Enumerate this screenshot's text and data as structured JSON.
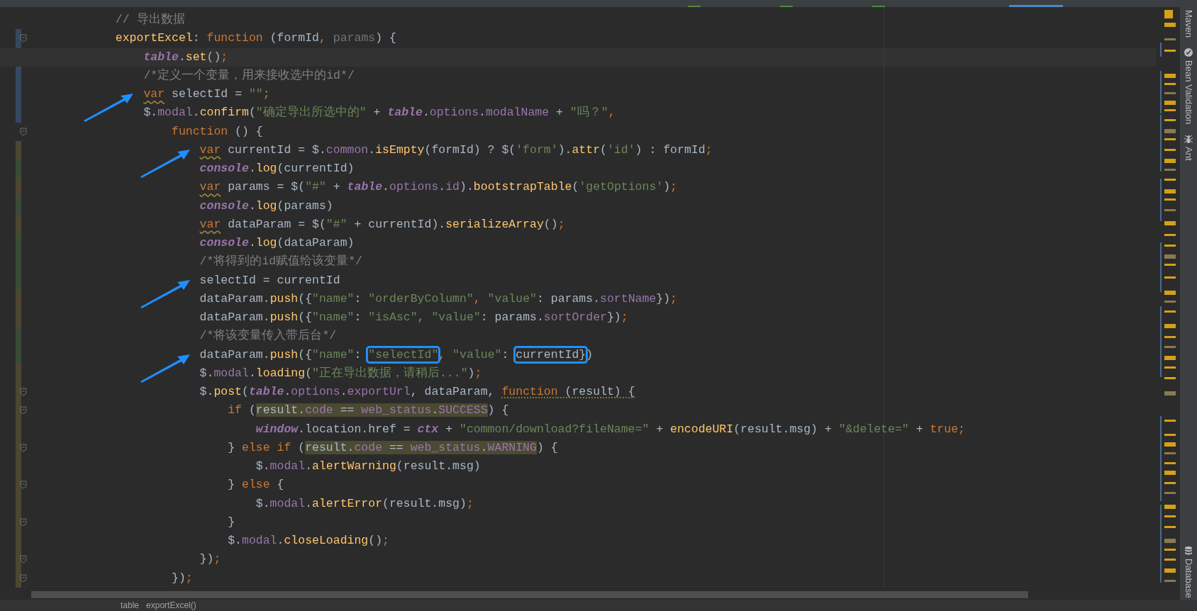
{
  "editor": {
    "lines": [
      {
        "fold": false,
        "current": false,
        "arrow": false,
        "tokens": [
          {
            "kind": "comment",
            "text": "// 导出数据"
          }
        ]
      },
      {
        "color": "#34495e",
        "fold": true,
        "current": false,
        "arrow": false,
        "tokens": [
          {
            "kind": "function",
            "text": "exportExcel"
          },
          {
            "kind": "plain",
            "text": ": "
          },
          {
            "kind": "keyword",
            "text": "function"
          },
          {
            "kind": "plain",
            "text": " (formId"
          },
          {
            "kind": "keyword",
            "text": ","
          },
          {
            "kind": "unused",
            "text": " params"
          },
          {
            "kind": "plain",
            "text": ") {"
          }
        ],
        "children": [
          {
            "fold": false,
            "current": true,
            "arrow": false,
            "tokens": [
              {
                "kind": "global",
                "text": "table"
              },
              {
                "kind": "plain",
                "text": "."
              },
              {
                "kind": "function",
                "text": "set"
              },
              {
                "kind": "plain",
                "text": "()"
              },
              {
                "kind": "keyword",
                "text": ";"
              }
            ]
          },
          {
            "color": "#34495e",
            "fold": false,
            "current": false,
            "arrow": false,
            "tokens": [
              {
                "kind": "comment",
                "text": "/*定义一个变量，用来接收选中的id*/"
              }
            ]
          },
          {
            "color": "#34495e",
            "fold": false,
            "current": false,
            "arrow": true,
            "tokens": [
              {
                "kind": "keyword",
                "text": "var",
                "warning": true
              },
              {
                "kind": "plain",
                "text": " selectId = "
              },
              {
                "kind": "string",
                "text": "\"\""
              },
              {
                "kind": "keyword",
                "text": ";"
              }
            ]
          },
          {
            "color": "#34495e",
            "fold": false,
            "current": false,
            "arrow": false,
            "tokens": [
              {
                "kind": "plain",
                "text": "$."
              },
              {
                "kind": "member",
                "text": "modal"
              },
              {
                "kind": "plain",
                "text": "."
              },
              {
                "kind": "function",
                "text": "confirm"
              },
              {
                "kind": "plain",
                "text": "("
              },
              {
                "kind": "string",
                "text": "\"确定导出所选中的\""
              },
              {
                "kind": "plain",
                "text": " + "
              },
              {
                "kind": "global",
                "text": "table"
              },
              {
                "kind": "plain",
                "text": "."
              },
              {
                "kind": "member",
                "text": "options"
              },
              {
                "kind": "plain",
                "text": "."
              },
              {
                "kind": "member",
                "text": "modalName"
              },
              {
                "kind": "plain",
                "text": " + "
              },
              {
                "kind": "string",
                "text": "\"吗？\""
              },
              {
                "kind": "keyword",
                "text": ","
              }
            ],
            "children": [
              {
                "fold": true,
                "current": false,
                "arrow": false,
                "tokens": [
                  {
                    "kind": "keyword",
                    "text": "function"
                  },
                  {
                    "kind": "plain",
                    "text": " () {"
                  }
                ],
                "children": [
                  {
                    "color": "#4d4631",
                    "fold": false,
                    "current": false,
                    "arrow": true,
                    "tokens": [
                      {
                        "kind": "keyword",
                        "text": "var",
                        "warning": true
                      },
                      {
                        "kind": "plain",
                        "text": " currentId = $."
                      },
                      {
                        "kind": "member",
                        "text": "common"
                      },
                      {
                        "kind": "plain",
                        "text": "."
                      },
                      {
                        "kind": "function",
                        "text": "isEmpty"
                      },
                      {
                        "kind": "plain",
                        "text": "(formId) ? $("
                      },
                      {
                        "kind": "string",
                        "text": "'form'"
                      },
                      {
                        "kind": "plain",
                        "text": ")."
                      },
                      {
                        "kind": "function",
                        "text": "attr"
                      },
                      {
                        "kind": "plain",
                        "text": "("
                      },
                      {
                        "kind": "string",
                        "text": "'id'"
                      },
                      {
                        "kind": "plain",
                        "text": ") : formId"
                      },
                      {
                        "kind": "keyword",
                        "text": ";"
                      }
                    ]
                  },
                  {
                    "color": "#384c38",
                    "fold": false,
                    "current": false,
                    "arrow": false,
                    "tokens": [
                      {
                        "kind": "global",
                        "text": "console"
                      },
                      {
                        "kind": "plain",
                        "text": "."
                      },
                      {
                        "kind": "function",
                        "text": "log"
                      },
                      {
                        "kind": "plain",
                        "text": "(currentId)"
                      }
                    ]
                  },
                  {
                    "color": "#4d4631",
                    "fold": false,
                    "current": false,
                    "arrow": false,
                    "tokens": [
                      {
                        "kind": "keyword",
                        "text": "var",
                        "warning": true
                      },
                      {
                        "kind": "plain",
                        "text": " params = $("
                      },
                      {
                        "kind": "string",
                        "text": "\"#\""
                      },
                      {
                        "kind": "plain",
                        "text": " + "
                      },
                      {
                        "kind": "global",
                        "text": "table"
                      },
                      {
                        "kind": "plain",
                        "text": "."
                      },
                      {
                        "kind": "member",
                        "text": "options"
                      },
                      {
                        "kind": "plain",
                        "text": "."
                      },
                      {
                        "kind": "member",
                        "text": "id"
                      },
                      {
                        "kind": "plain",
                        "text": ")."
                      },
                      {
                        "kind": "function",
                        "text": "bootstrapTable"
                      },
                      {
                        "kind": "plain",
                        "text": "("
                      },
                      {
                        "kind": "string",
                        "text": "'getOptions'"
                      },
                      {
                        "kind": "plain",
                        "text": ")"
                      },
                      {
                        "kind": "keyword",
                        "text": ";"
                      }
                    ]
                  },
                  {
                    "color": "#384c38",
                    "fold": false,
                    "current": false,
                    "arrow": false,
                    "tokens": [
                      {
                        "kind": "global",
                        "text": "console"
                      },
                      {
                        "kind": "plain",
                        "text": "."
                      },
                      {
                        "kind": "function",
                        "text": "log"
                      },
                      {
                        "kind": "plain",
                        "text": "(params)"
                      }
                    ]
                  },
                  {
                    "color": "#4d4631",
                    "fold": false,
                    "current": false,
                    "arrow": false,
                    "tokens": [
                      {
                        "kind": "keyword",
                        "text": "var",
                        "warning": true
                      },
                      {
                        "kind": "plain",
                        "text": " dataParam = $("
                      },
                      {
                        "kind": "string",
                        "text": "\"#\""
                      },
                      {
                        "kind": "plain",
                        "text": " + currentId)."
                      },
                      {
                        "kind": "function",
                        "text": "serializeArray"
                      },
                      {
                        "kind": "plain",
                        "text": "()"
                      },
                      {
                        "kind": "keyword",
                        "text": ";"
                      }
                    ]
                  },
                  {
                    "color": "#384c38",
                    "fold": false,
                    "current": false,
                    "arrow": false,
                    "tokens": [
                      {
                        "kind": "global",
                        "text": "console"
                      },
                      {
                        "kind": "plain",
                        "text": "."
                      },
                      {
                        "kind": "function",
                        "text": "log"
                      },
                      {
                        "kind": "plain",
                        "text": "(dataParam)"
                      }
                    ]
                  },
                  {
                    "color": "#384c38",
                    "fold": false,
                    "current": false,
                    "arrow": false,
                    "tokens": [
                      {
                        "kind": "comment",
                        "text": "/*将得到的id赋值给该变量*/"
                      }
                    ]
                  },
                  {
                    "color": "#384c38",
                    "fold": false,
                    "current": false,
                    "arrow": true,
                    "tokens": [
                      {
                        "kind": "plain",
                        "text": "selectId = currentId"
                      }
                    ]
                  },
                  {
                    "color": "#4d4631",
                    "fold": false,
                    "current": false,
                    "arrow": false,
                    "tokens": [
                      {
                        "kind": "plain",
                        "text": "dataParam."
                      },
                      {
                        "kind": "function",
                        "text": "push"
                      },
                      {
                        "kind": "plain",
                        "text": "({"
                      },
                      {
                        "kind": "string",
                        "text": "\"name\""
                      },
                      {
                        "kind": "plain",
                        "text": ": "
                      },
                      {
                        "kind": "string",
                        "text": "\"orderByColumn\""
                      },
                      {
                        "kind": "keyword",
                        "text": ","
                      },
                      {
                        "kind": "string",
                        "text": " \"value\""
                      },
                      {
                        "kind": "plain",
                        "text": ": params."
                      },
                      {
                        "kind": "member",
                        "text": "sortName"
                      },
                      {
                        "kind": "plain",
                        "text": "})"
                      },
                      {
                        "kind": "keyword",
                        "text": ";"
                      }
                    ]
                  },
                  {
                    "color": "#4d4631",
                    "fold": false,
                    "current": false,
                    "arrow": false,
                    "tokens": [
                      {
                        "kind": "plain",
                        "text": "dataParam."
                      },
                      {
                        "kind": "function",
                        "text": "push"
                      },
                      {
                        "kind": "plain",
                        "text": "({"
                      },
                      {
                        "kind": "string",
                        "text": "\"name\""
                      },
                      {
                        "kind": "plain",
                        "text": ": "
                      },
                      {
                        "kind": "string",
                        "text": "\"isAsc\""
                      },
                      {
                        "kind": "keyword",
                        "text": ","
                      },
                      {
                        "kind": "string",
                        "text": " \"value\""
                      },
                      {
                        "kind": "plain",
                        "text": ": params."
                      },
                      {
                        "kind": "member",
                        "text": "sortOrder"
                      },
                      {
                        "kind": "plain",
                        "text": "})"
                      },
                      {
                        "kind": "keyword",
                        "text": ";"
                      }
                    ]
                  },
                  {
                    "color": "#384c38",
                    "fold": false,
                    "current": false,
                    "arrow": false,
                    "tokens": [
                      {
                        "kind": "comment",
                        "text": "/*将该变量传入带后台*/"
                      }
                    ]
                  },
                  {
                    "color": "#384c38",
                    "fold": false,
                    "current": false,
                    "arrow": true,
                    "tokens": [
                      {
                        "kind": "plain",
                        "text": "dataParam."
                      },
                      {
                        "kind": "function",
                        "text": "push"
                      },
                      {
                        "kind": "plain",
                        "text": "({"
                      },
                      {
                        "kind": "string",
                        "text": "\"name\""
                      },
                      {
                        "kind": "plain",
                        "text": ": "
                      },
                      {
                        "kind": "string",
                        "text": "\"selectId\"",
                        "boxed": true
                      },
                      {
                        "kind": "keyword",
                        "text": ","
                      },
                      {
                        "kind": "string",
                        "text": " \"value\""
                      },
                      {
                        "kind": "plain",
                        "text": ": "
                      },
                      {
                        "kind": "plain",
                        "text": "currentId}",
                        "boxed": true
                      },
                      {
                        "kind": "plain",
                        "text": ")"
                      }
                    ]
                  },
                  {
                    "color": "#4d4631",
                    "fold": false,
                    "current": false,
                    "arrow": false,
                    "tokens": [
                      {
                        "kind": "plain",
                        "text": "$."
                      },
                      {
                        "kind": "member",
                        "text": "modal"
                      },
                      {
                        "kind": "plain",
                        "text": "."
                      },
                      {
                        "kind": "function",
                        "text": "loading"
                      },
                      {
                        "kind": "plain",
                        "text": "("
                      },
                      {
                        "kind": "string",
                        "text": "\"正在导出数据，请稍后...\""
                      },
                      {
                        "kind": "plain",
                        "text": ")"
                      },
                      {
                        "kind": "keyword",
                        "text": ";"
                      }
                    ]
                  },
                  {
                    "color": "#4d4631",
                    "fold": true,
                    "current": false,
                    "arrow": false,
                    "tokens": [
                      {
                        "kind": "plain",
                        "text": "$."
                      },
                      {
                        "kind": "function",
                        "text": "post"
                      },
                      {
                        "kind": "plain",
                        "text": "("
                      },
                      {
                        "kind": "global",
                        "text": "table"
                      },
                      {
                        "kind": "plain",
                        "text": "."
                      },
                      {
                        "kind": "member",
                        "text": "options"
                      },
                      {
                        "kind": "plain",
                        "text": "."
                      },
                      {
                        "kind": "member",
                        "text": "exportUrl"
                      },
                      {
                        "kind": "plain",
                        "text": ", dataParam, "
                      },
                      {
                        "kind": "keyword",
                        "text": "function",
                        "weak_warning": true
                      },
                      {
                        "kind": "plain",
                        "text": " (result) {",
                        "weak_warning": true
                      }
                    ],
                    "children": [
                      {
                        "color": "#4d4631",
                        "fold": true,
                        "current": false,
                        "arrow": false,
                        "tokens": [
                          {
                            "kind": "keyword",
                            "text": "if"
                          },
                          {
                            "kind": "plain",
                            "text": " ("
                          },
                          {
                            "kind": "plain",
                            "text": "result.",
                            "highlight": true
                          },
                          {
                            "kind": "member",
                            "text": "code",
                            "highlight": true
                          },
                          {
                            "kind": "plain",
                            "text": " == ",
                            "highlight": true
                          },
                          {
                            "kind": "member",
                            "text": "web_status",
                            "highlight": true
                          },
                          {
                            "kind": "plain",
                            "text": ".",
                            "highlight": true
                          },
                          {
                            "kind": "member",
                            "text": "SUCCESS",
                            "highlight": true
                          },
                          {
                            "kind": "plain",
                            "text": ") {"
                          }
                        ],
                        "children": [
                          {
                            "color": "#4d4631",
                            "fold": false,
                            "current": false,
                            "arrow": false,
                            "tokens": [
                              {
                                "kind": "global",
                                "text": "window"
                              },
                              {
                                "kind": "plain",
                                "text": ".location.href = "
                              },
                              {
                                "kind": "global",
                                "text": "ctx"
                              },
                              {
                                "kind": "plain",
                                "text": " + "
                              },
                              {
                                "kind": "string",
                                "text": "\"common/download?fileName=\""
                              },
                              {
                                "kind": "plain",
                                "text": " + "
                              },
                              {
                                "kind": "function",
                                "text": "encodeURI"
                              },
                              {
                                "kind": "plain",
                                "text": "(result.msg) + "
                              },
                              {
                                "kind": "string",
                                "text": "\"&delete=\""
                              },
                              {
                                "kind": "plain",
                                "text": " + "
                              },
                              {
                                "kind": "keyword",
                                "text": "true;"
                              }
                            ]
                          }
                        ]
                      },
                      {
                        "color": "#4d4631",
                        "fold": true,
                        "current": false,
                        "arrow": false,
                        "tokens": [
                          {
                            "kind": "plain",
                            "text": "} "
                          },
                          {
                            "kind": "keyword",
                            "text": "else if"
                          },
                          {
                            "kind": "plain",
                            "text": " ("
                          },
                          {
                            "kind": "plain",
                            "text": "result.",
                            "highlight": true
                          },
                          {
                            "kind": "member",
                            "text": "code",
                            "highlight": true
                          },
                          {
                            "kind": "plain",
                            "text": " == ",
                            "highlight": true
                          },
                          {
                            "kind": "member",
                            "text": "web_status",
                            "highlight": true
                          },
                          {
                            "kind": "plain",
                            "text": ".",
                            "highlight": true
                          },
                          {
                            "kind": "member",
                            "text": "WARNING",
                            "highlight": true
                          },
                          {
                            "kind": "plain",
                            "text": ") {"
                          }
                        ],
                        "children": [
                          {
                            "color": "#4d4631",
                            "fold": false,
                            "current": false,
                            "arrow": false,
                            "tokens": [
                              {
                                "kind": "plain",
                                "text": "$."
                              },
                              {
                                "kind": "member",
                                "text": "modal"
                              },
                              {
                                "kind": "plain",
                                "text": "."
                              },
                              {
                                "kind": "function",
                                "text": "alertWarning"
                              },
                              {
                                "kind": "plain",
                                "text": "(result.msg)"
                              }
                            ]
                          }
                        ]
                      },
                      {
                        "color": "#4d4631",
                        "fold": true,
                        "current": false,
                        "arrow": false,
                        "tokens": [
                          {
                            "kind": "plain",
                            "text": "} "
                          },
                          {
                            "kind": "keyword",
                            "text": "else"
                          },
                          {
                            "kind": "plain",
                            "text": " {"
                          }
                        ],
                        "children": [
                          {
                            "color": "#4d4631",
                            "fold": false,
                            "current": false,
                            "arrow": false,
                            "tokens": [
                              {
                                "kind": "plain",
                                "text": "$."
                              },
                              {
                                "kind": "member",
                                "text": "modal"
                              },
                              {
                                "kind": "plain",
                                "text": "."
                              },
                              {
                                "kind": "function",
                                "text": "alertError"
                              },
                              {
                                "kind": "plain",
                                "text": "(result.msg)"
                              },
                              {
                                "kind": "keyword",
                                "text": ";"
                              }
                            ]
                          }
                        ]
                      },
                      {
                        "color": "#4d4631",
                        "fold": true,
                        "current": false,
                        "arrow": false,
                        "tokens": [
                          {
                            "kind": "plain",
                            "text": "}"
                          }
                        ]
                      },
                      {
                        "color": "#4d4631",
                        "fold": false,
                        "current": false,
                        "arrow": false,
                        "tokens": [
                          {
                            "kind": "plain",
                            "text": "$."
                          },
                          {
                            "kind": "member",
                            "text": "modal"
                          },
                          {
                            "kind": "plain",
                            "text": "."
                          },
                          {
                            "kind": "function",
                            "text": "closeLoading"
                          },
                          {
                            "kind": "plain",
                            "text": "()"
                          },
                          {
                            "kind": "keyword",
                            "text": ";"
                          }
                        ]
                      }
                    ]
                  },
                  {
                    "color": "#4d4631",
                    "fold": true,
                    "current": false,
                    "arrow": false,
                    "tokens": [
                      {
                        "kind": "plain",
                        "text": "})"
                      },
                      {
                        "kind": "keyword",
                        "text": ";"
                      }
                    ]
                  }
                ]
              },
              {
                "color": "#4d4631",
                "fold": true,
                "current": false,
                "arrow": false,
                "tokens": [
                  {
                    "kind": "plain",
                    "text": "})"
                  },
                  {
                    "kind": "keyword",
                    "text": ";"
                  }
                ]
              }
            ]
          }
        ]
      }
    ]
  },
  "tool_windows": [
    "Maven",
    "Bean Validation",
    "Ant",
    "Database"
  ],
  "breadcrumbs": [
    "table",
    "exportExcel()"
  ]
}
